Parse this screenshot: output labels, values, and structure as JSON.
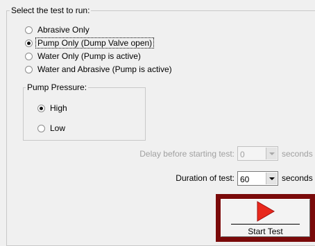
{
  "test_group": {
    "legend": "Select the test to run:",
    "options": [
      {
        "label": "Abrasive Only",
        "checked": false
      },
      {
        "label": "Pump Only (Dump Valve open)",
        "checked": true
      },
      {
        "label": "Water Only (Pump is active)",
        "checked": false
      },
      {
        "label": "Water and Abrasive (Pump is active)",
        "checked": false
      }
    ]
  },
  "pressure_group": {
    "legend": "Pump Pressure:",
    "options": [
      {
        "label": "High",
        "checked": true
      },
      {
        "label": "Low",
        "checked": false
      }
    ]
  },
  "delay": {
    "label": "Delay before starting test:",
    "value": "0",
    "unit": "seconds",
    "enabled": false
  },
  "duration": {
    "label": "Duration of test:",
    "value": "60",
    "unit": "seconds",
    "enabled": true
  },
  "start_button": {
    "label": "Start Test",
    "icon": "play-arrow-icon",
    "icon_color": "#e8281c",
    "frame_color": "#7a0a0a"
  }
}
